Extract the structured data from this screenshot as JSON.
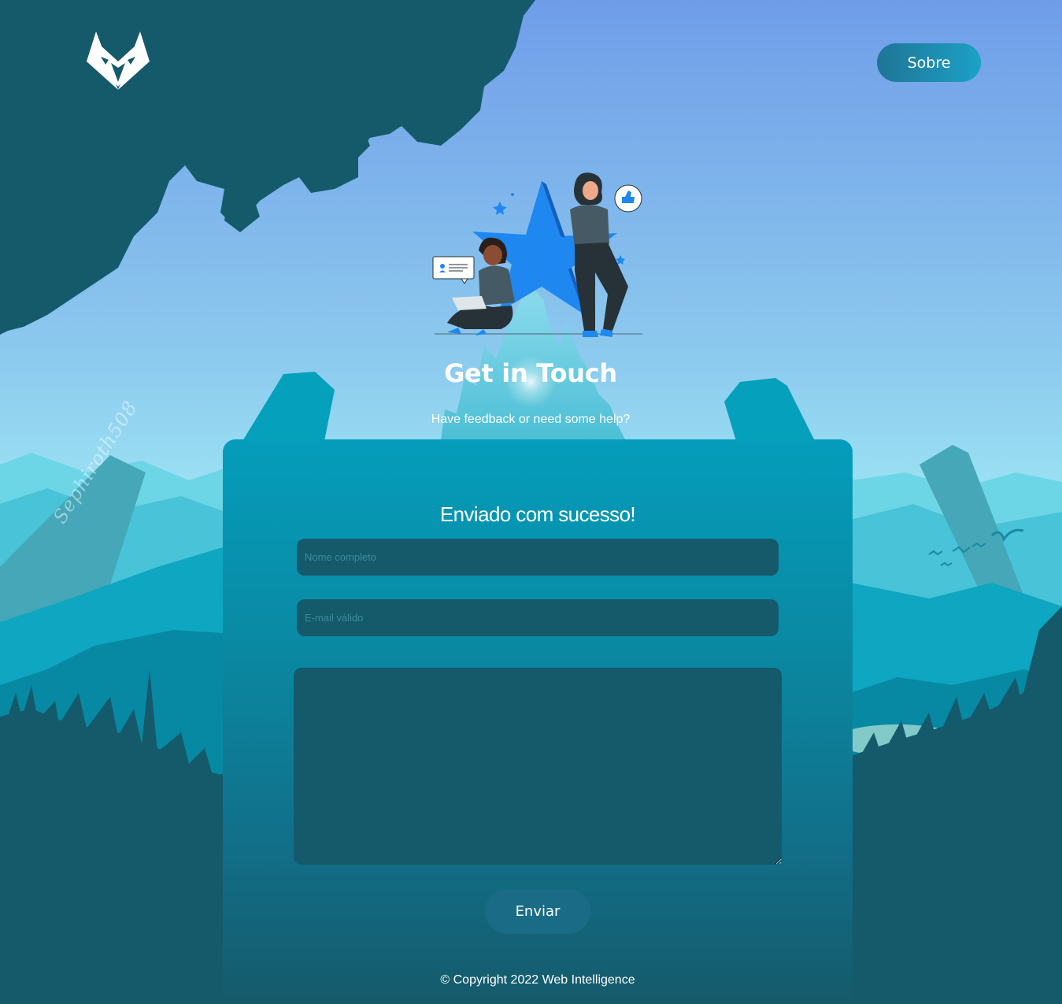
{
  "header": {
    "logo_icon": "fox-logo-icon",
    "about_label": "Sobre"
  },
  "hero": {
    "illustration": "feedback-star-illustration",
    "title": "Get in Touch",
    "subtitle": "Have feedback or need some help?"
  },
  "background": {
    "watermark": "Sephiroth508"
  },
  "form": {
    "status": "Enviado com sucesso!",
    "name_placeholder": "Nome completo",
    "email_placeholder": "E-mail válido",
    "message_placeholder": "",
    "submit_label": "Enviar"
  },
  "footer": {
    "copyright": "© Copyright 2022 Web Intelligence"
  },
  "colors": {
    "sky_top": "#6f9de9",
    "sky_bottom": "#a6f4f8",
    "dark_teal": "#155a6b",
    "card_top": "#049dbb",
    "accent_blue": "#1e88f0"
  }
}
